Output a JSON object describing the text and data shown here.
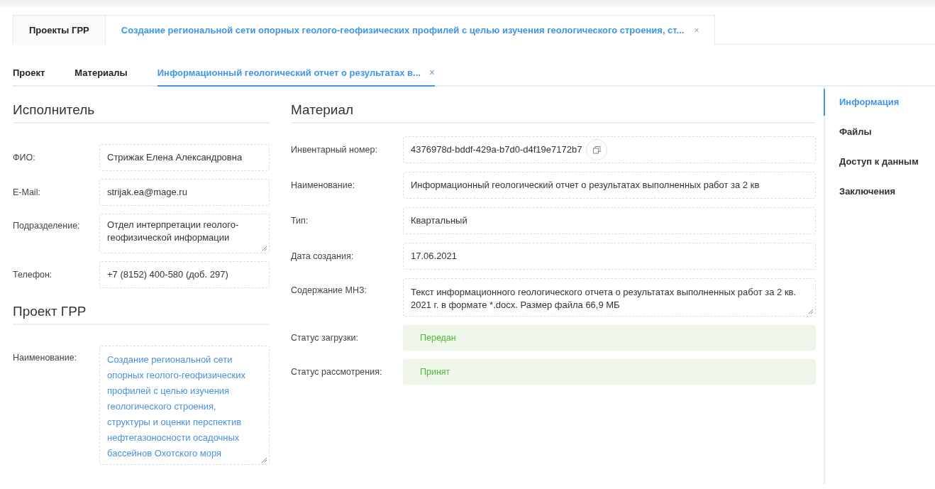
{
  "top_tabs": [
    {
      "label": "Проекты ГРР",
      "selected": false
    },
    {
      "label": "Создание региональной сети опорных геолого-геофизических профилей с целью изучения геологического строения, ст...",
      "selected": true,
      "close": "×"
    }
  ],
  "sub_tabs": [
    {
      "label": "Проект",
      "selected": false
    },
    {
      "label": "Материалы",
      "selected": false
    },
    {
      "label": "Информационный геологический отчет о результатах в...",
      "selected": true,
      "close": "×"
    }
  ],
  "left_sections": [
    {
      "title": "Исполнитель",
      "fields": [
        {
          "label": "ФИО:",
          "kind": "input",
          "value": "Стрижак Елена Александровна"
        },
        {
          "label": "E-Mail:",
          "kind": "input",
          "value": "strijak.ea@mage.ru"
        },
        {
          "label": "Подразделение:",
          "kind": "textarea",
          "value": "Отдел интерпретации геолого-геофизической информации"
        },
        {
          "label": "Телефон:",
          "kind": "input",
          "value": "+7 (8152) 400-580 (доб. 297)"
        }
      ]
    },
    {
      "title": "Проект ГРР",
      "fields": [
        {
          "label": "Наименование:",
          "kind": "link",
          "value": "Создание региональной сети опорных геолого-геофизических профилей с целью изучения геологического строения, структуры и оценки перспектив нефтегазоносности осадочных бассейнов Охотского моря"
        }
      ]
    }
  ],
  "material": {
    "title": "Материал",
    "fields": [
      {
        "label": "Инвентарный номер:",
        "kind": "copy",
        "value": "4376978d-bddf-429a-b7d0-d4f19e7172b7"
      },
      {
        "label": "Наименование:",
        "kind": "input",
        "value": "Информационный геологический отчет о результатах выполненных работ за 2 кв"
      },
      {
        "label": "Тип:",
        "kind": "input",
        "value": "Квартальный"
      },
      {
        "label": "Дата создания:",
        "kind": "input",
        "value": "17.06.2021"
      },
      {
        "label": "Содержание МНЗ:",
        "kind": "textarea",
        "value": "Текст информационного геологического отчета о результатах выполненных работ за 2 кв. 2021 г. в формате *.docx. Размер файла 66,9 МБ"
      },
      {
        "label": "Статус загрузки:",
        "kind": "status",
        "value": "Передан"
      },
      {
        "label": "Статус рассмотрения:",
        "kind": "status",
        "value": "Принят"
      }
    ]
  },
  "side_nav": [
    {
      "label": "Информация",
      "selected": true
    },
    {
      "label": "Файлы",
      "selected": false
    },
    {
      "label": "Доступ к данным",
      "selected": false
    },
    {
      "label": "Заключения",
      "selected": false
    }
  ]
}
